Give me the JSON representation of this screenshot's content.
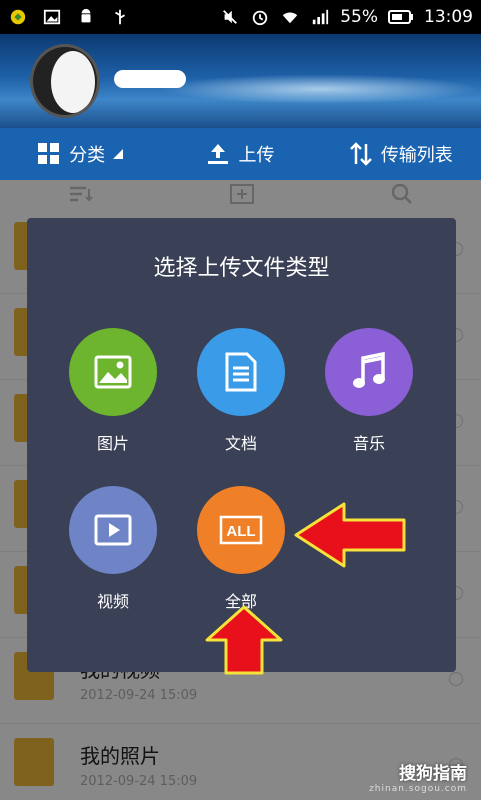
{
  "status_bar": {
    "battery": "55%",
    "time": "13:09"
  },
  "toolbar": {
    "category_label": "分类",
    "upload_label": "上传",
    "transfer_label": "传输列表"
  },
  "list": {
    "items": [
      {
        "title": "",
        "date": ""
      },
      {
        "title": "",
        "date": ""
      },
      {
        "title": "",
        "date": ""
      },
      {
        "title": "",
        "date": ""
      },
      {
        "title": "",
        "date": ""
      },
      {
        "title": "我的视频",
        "date": "2012-09-24  15:09"
      },
      {
        "title": "我的照片",
        "date": "2012-09-24  15:09"
      }
    ]
  },
  "dialog": {
    "title": "选择上传文件类型",
    "options": [
      {
        "label": "图片",
        "color": "#6db52e",
        "icon": "image-icon"
      },
      {
        "label": "文档",
        "color": "#3a9be8",
        "icon": "document-icon"
      },
      {
        "label": "音乐",
        "color": "#8b5fd6",
        "icon": "music-icon"
      },
      {
        "label": "视频",
        "color": "#6e84c6",
        "icon": "video-icon"
      },
      {
        "label": "全部",
        "color": "#f08027",
        "icon": "all-icon",
        "icon_text": "ALL"
      }
    ]
  },
  "watermark": {
    "main": "搜狗指南",
    "sub": "zhinan.sogou.com"
  }
}
